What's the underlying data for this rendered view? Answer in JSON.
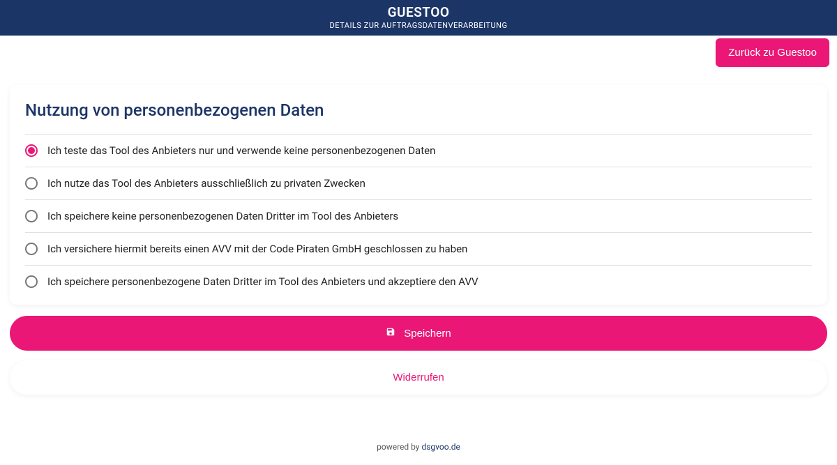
{
  "header": {
    "title": "GUESTOO",
    "subtitle": "DETAILS ZUR AUFTRAGSDATENVERARBEITUNG"
  },
  "back_button": "Zurück zu Guestoo",
  "panel": {
    "title": "Nutzung von personenbezogenen Daten",
    "options": [
      "Ich teste das Tool des Anbieters nur und verwende keine personenbezogenen Daten",
      "Ich nutze das Tool des Anbieters ausschließlich zu privaten Zwecken",
      "Ich speichere keine personenbezogenen Daten Dritter im Tool des Anbieters",
      "Ich versichere hiermit bereits einen AVV mit der Code Piraten GmbH geschlossen zu haben",
      "Ich speichere personenbezogene Daten Dritter im Tool des Anbieters und akzeptiere den AVV"
    ],
    "selected_index": 0
  },
  "buttons": {
    "save": "Speichern",
    "revoke": "Widerrufen"
  },
  "footer": {
    "prefix": "powered by ",
    "link": "dsgvoo.de"
  }
}
